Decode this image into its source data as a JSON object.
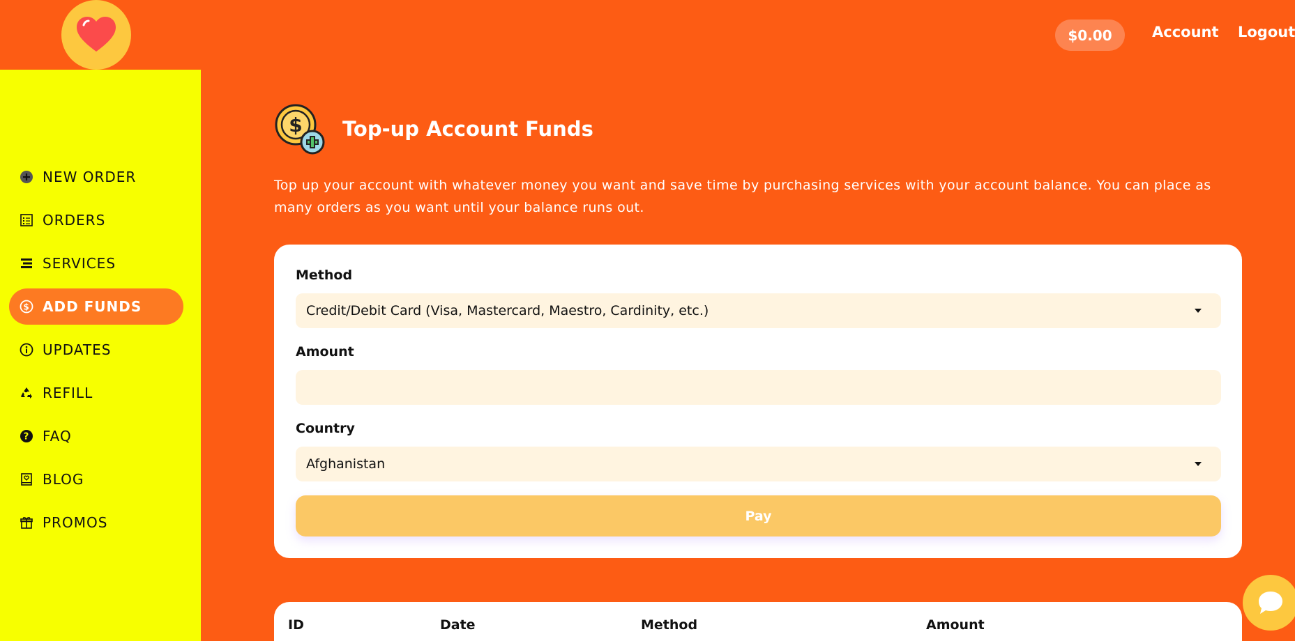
{
  "header": {
    "balance": "$0.00",
    "account_link": "Account",
    "logout_link": "Logout"
  },
  "sidebar": {
    "items": [
      {
        "label": "NEW ORDER",
        "icon": "plus-circle-icon"
      },
      {
        "label": "ORDERS",
        "icon": "list-icon"
      },
      {
        "label": "SERVICES",
        "icon": "bars-icon"
      },
      {
        "label": "ADD FUNDS",
        "icon": "dollar-circle-icon",
        "active": true
      },
      {
        "label": "UPDATES",
        "icon": "info-icon"
      },
      {
        "label": "REFILL",
        "icon": "recycle-icon"
      },
      {
        "label": "FAQ",
        "icon": "question-circle-icon"
      },
      {
        "label": "BLOG",
        "icon": "book-heart-icon"
      },
      {
        "label": "PROMOS",
        "icon": "gift-icon"
      }
    ]
  },
  "main": {
    "title": "Top-up Account Funds",
    "intro": "Top up your account with whatever money you want and save time by purchasing services with your account balance. You can place as many orders as you want until your balance runs out.",
    "form": {
      "method_label": "Method",
      "method_value": "Credit/Debit Card (Visa, Mastercard, Maestro, Cardinity, etc.)",
      "amount_label": "Amount",
      "amount_value": "",
      "country_label": "Country",
      "country_value": "Afghanistan",
      "pay_label": "Pay"
    },
    "history_table": {
      "columns": [
        "ID",
        "Date",
        "Method",
        "Amount"
      ]
    }
  },
  "colors": {
    "background": "#fd5c14",
    "sidebar": "#f7ff00",
    "active_item": "#fd7a22",
    "accent": "#fdc83f",
    "field": "#fff4e0",
    "pay_button": "#fbc865"
  }
}
